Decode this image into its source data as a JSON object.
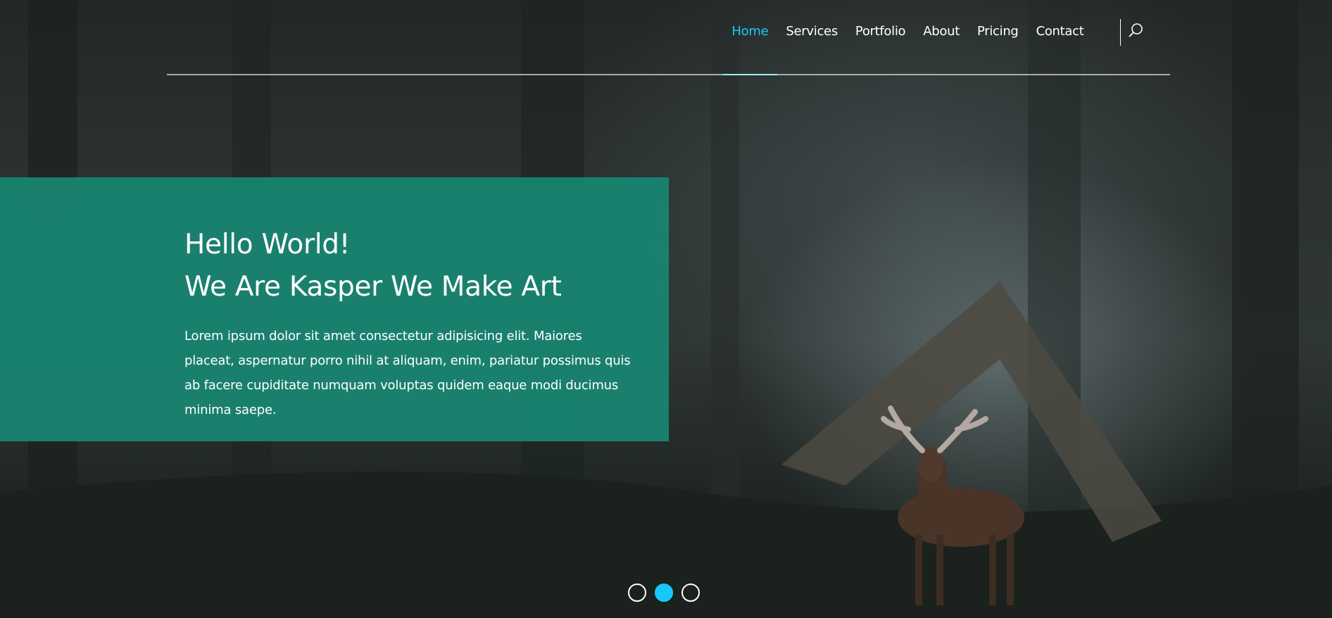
{
  "nav": {
    "items": [
      {
        "label": "Home",
        "active": true
      },
      {
        "label": "Services",
        "active": false
      },
      {
        "label": "Portfolio",
        "active": false
      },
      {
        "label": "About",
        "active": false
      },
      {
        "label": "Pricing",
        "active": false
      },
      {
        "label": "Contact",
        "active": false
      }
    ],
    "search_icon": "search-icon"
  },
  "intro": {
    "title_line1": "Hello World!",
    "title_line2": "We Are Kasper We Make Art",
    "text": "Lorem ipsum dolor sit amet consectetur adipisicing elit. Maiores placeat, aspernatur porro nihil at aliquam, enim, pariatur possimus quis ab facere cupiditate numquam voluptas quidem eaque modi ducimus minima saepe."
  },
  "slider": {
    "bullets": [
      {
        "active": false
      },
      {
        "active": true
      },
      {
        "active": false
      }
    ]
  },
  "colors": {
    "accent": "#19c8fa",
    "intro_bg": "#1a8876"
  }
}
